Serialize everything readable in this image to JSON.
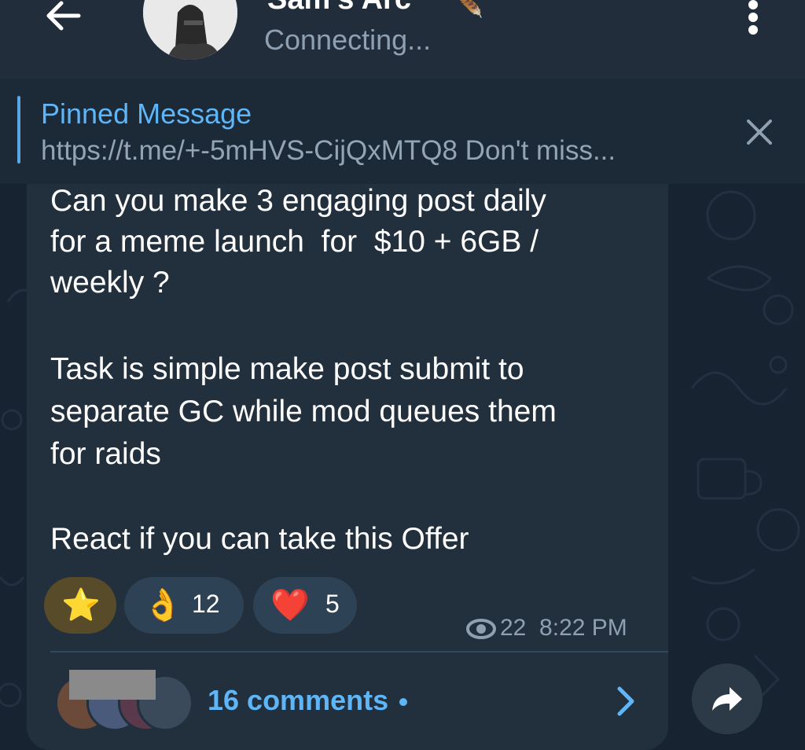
{
  "header": {
    "title": "Sam's Arc",
    "status": "Connecting..."
  },
  "pinned": {
    "label": "Pinned Message",
    "text": "https://t.me/+-5mHVS-CijQxMTQ8  Don't miss..."
  },
  "message": {
    "lines": [
      "Can you make 3 engaging post daily",
      "for a meme launch  for  $10 + 6GB /",
      "weekly ?",
      "Task is simple make post submit to",
      "separate GC while mod queues them",
      "for raids",
      "React if you can take this Offer"
    ],
    "reactions": [
      {
        "emoji": "⭐",
        "count": ""
      },
      {
        "emoji": "👌",
        "count": "12"
      },
      {
        "emoji": "❤️",
        "count": "5"
      }
    ],
    "views": "22",
    "time": "8:22 PM"
  },
  "comments": {
    "label": "16 comments"
  },
  "colors": {
    "accent": "#5eb5f7",
    "header_bg": "#212d3b",
    "bubble_bg": "#222f3d"
  },
  "icons": [
    "back-arrow-icon",
    "more-vertical-icon",
    "close-icon",
    "star-icon",
    "ok-hand-icon",
    "heart-icon",
    "eye-icon",
    "chevron-right-icon",
    "share-arrow-icon"
  ]
}
